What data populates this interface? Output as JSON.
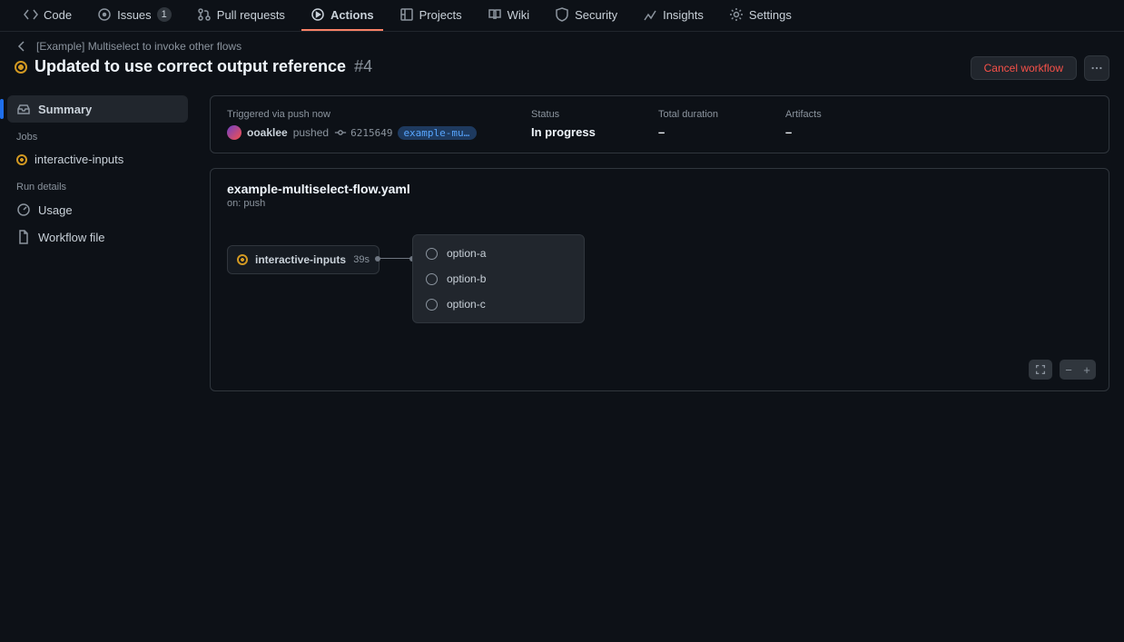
{
  "nav": {
    "code": "Code",
    "issues": "Issues",
    "issues_count": "1",
    "pulls": "Pull requests",
    "actions": "Actions",
    "projects": "Projects",
    "wiki": "Wiki",
    "security": "Security",
    "insights": "Insights",
    "settings": "Settings"
  },
  "breadcrumb": {
    "workflow_name": "[Example] Multiselect to invoke other flows"
  },
  "run": {
    "title": "Updated to use correct output reference",
    "number": "#4",
    "cancel": "Cancel workflow"
  },
  "sidebar": {
    "summary": "Summary",
    "jobs_heading": "Jobs",
    "job1": "interactive-inputs",
    "details_heading": "Run details",
    "usage": "Usage",
    "workflow_file": "Workflow file"
  },
  "summary": {
    "triggered_label": "Triggered via push now",
    "actor": "ooaklee",
    "pushed": "pushed",
    "sha": "6215649",
    "branch": "example-multiselect-flow-to…",
    "status_label": "Status",
    "status_value": "In progress",
    "duration_label": "Total duration",
    "duration_value": "–",
    "artifacts_label": "Artifacts",
    "artifacts_value": "–"
  },
  "graph": {
    "filename": "example-multiselect-flow.yaml",
    "trigger": "on: push",
    "primary_job": "interactive-inputs",
    "elapsed": "39s",
    "options": {
      "a": "option-a",
      "b": "option-b",
      "c": "option-c"
    },
    "zoom_out": "−",
    "zoom_in": "+"
  }
}
